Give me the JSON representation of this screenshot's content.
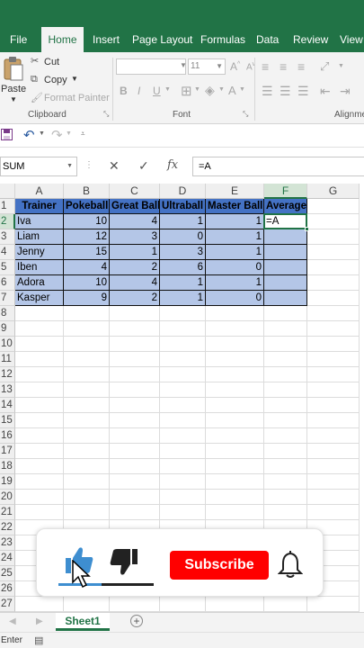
{
  "ribbon_tabs": [
    "File",
    "Home",
    "Insert",
    "Page Layout",
    "Formulas",
    "Data",
    "Review",
    "View"
  ],
  "active_tab": "Home",
  "clipboard": {
    "paste_label": "Paste",
    "cut_label": "Cut",
    "copy_label": "Copy",
    "format_painter_label": "Format Painter",
    "group_label": "Clipboard"
  },
  "font_group": {
    "font_size": "11",
    "group_label": "Font",
    "bold": "B",
    "italic": "I",
    "underline": "U",
    "font_color_letter": "A"
  },
  "alignment_group_label": "Alignme",
  "formula_bar": {
    "name_box": "SUM",
    "formula": "=A"
  },
  "columns": [
    "A",
    "B",
    "C",
    "D",
    "E",
    "F",
    "G"
  ],
  "rows": [
    "1",
    "2",
    "3",
    "4",
    "5",
    "6",
    "7",
    "8",
    "9",
    "10",
    "11",
    "12",
    "13",
    "14",
    "15",
    "16",
    "17",
    "18",
    "19",
    "20",
    "21",
    "22",
    "23",
    "24",
    "25",
    "26",
    "27"
  ],
  "table": {
    "headers": [
      "Trainer",
      "Pokeball",
      "Great Ball",
      "Ultraball",
      "Master Ball",
      "Average"
    ],
    "rows": [
      [
        "Iva",
        "10",
        "4",
        "1",
        "1",
        "=A"
      ],
      [
        "Liam",
        "12",
        "3",
        "0",
        "1",
        ""
      ],
      [
        "Jenny",
        "15",
        "1",
        "3",
        "1",
        ""
      ],
      [
        "Iben",
        "4",
        "2",
        "6",
        "0",
        ""
      ],
      [
        "Adora",
        "10",
        "4",
        "1",
        "1",
        ""
      ],
      [
        "Kasper",
        "9",
        "2",
        "1",
        "0",
        ""
      ]
    ]
  },
  "sheet_tab": "Sheet1",
  "status_text": "Enter",
  "overlay": {
    "subscribe_label": "Subscribe"
  },
  "colors": {
    "excel_green": "#217346",
    "table_header": "#4472c4",
    "table_body": "#b4c6e7",
    "subscribe_red": "#ff0000",
    "like_blue": "#3e8ed0"
  }
}
